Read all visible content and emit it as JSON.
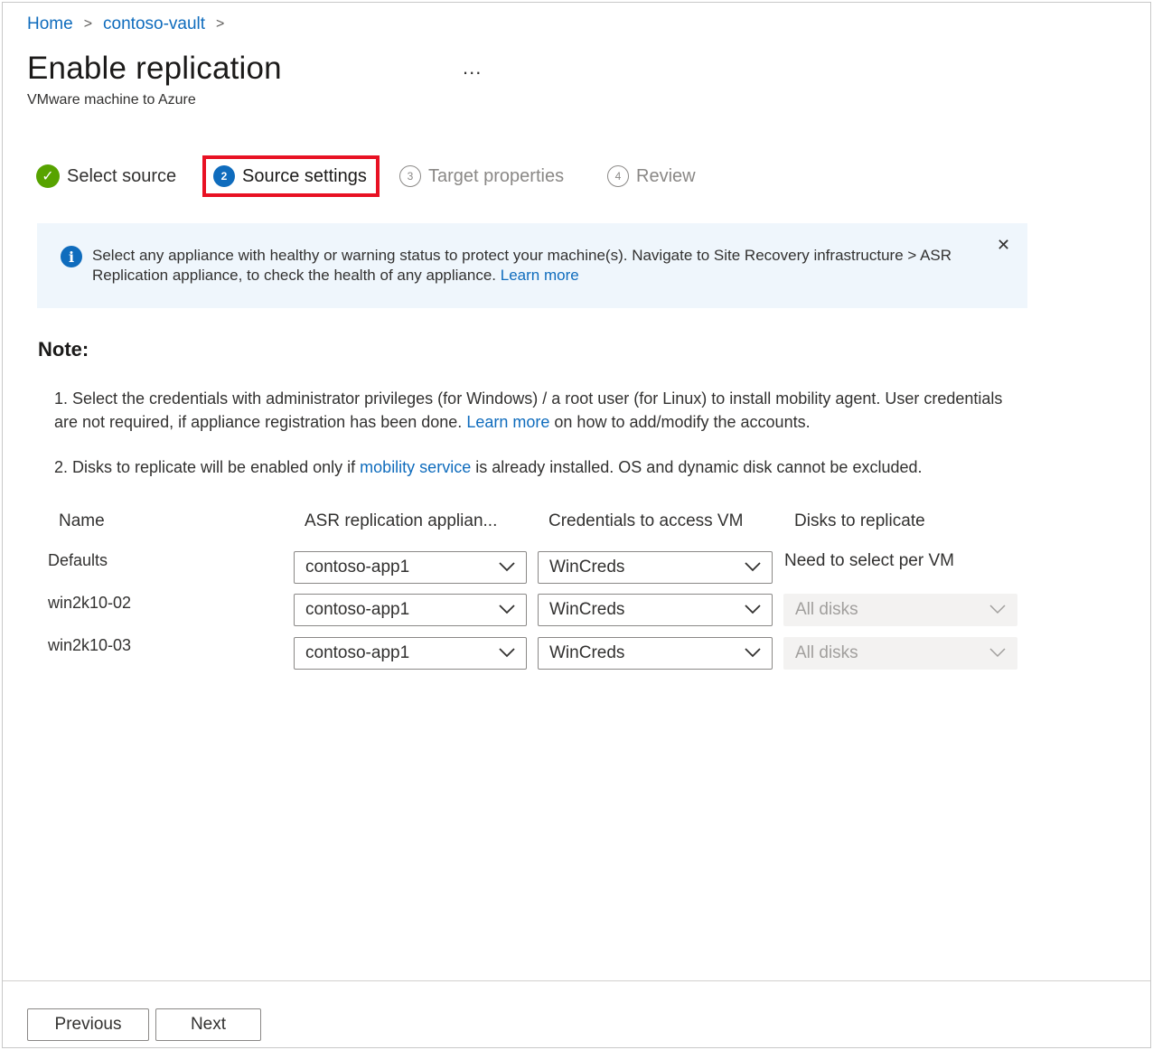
{
  "breadcrumb": {
    "items": [
      "Home",
      "contoso-vault"
    ],
    "separator": ">"
  },
  "header": {
    "title": "Enable replication",
    "subtitle": "VMware machine to Azure",
    "more": "..."
  },
  "steps": [
    {
      "marker": "✓",
      "label": "Select source",
      "state": "completed"
    },
    {
      "marker": "2",
      "label": "Source settings",
      "state": "current"
    },
    {
      "marker": "3",
      "label": "Target properties",
      "state": "upcoming"
    },
    {
      "marker": "4",
      "label": "Review",
      "state": "upcoming"
    }
  ],
  "info_bar": {
    "icon": "info-icon",
    "text": "Select any appliance with healthy or warning status to protect your machine(s). Navigate to Site Recovery infrastructure > ASR Replication appliance, to check the health of any appliance.",
    "link": "Learn more",
    "close": "✕"
  },
  "note": {
    "heading": "Note:",
    "item1": {
      "num": "1.",
      "text_a": "Select the credentials with administrator privileges (for Windows) / a root user (for Linux) to install mobility agent. User credentials are not required, if appliance registration has been done.",
      "link": "Learn more",
      "text_b": "on how to add/modify the accounts."
    },
    "item2": {
      "num": "2.",
      "text_a": "Disks to replicate will be enabled only if",
      "link": "mobility service",
      "text_b": "is already installed. OS and dynamic disk cannot be excluded."
    }
  },
  "table": {
    "headers": [
      "Name",
      "ASR replication applian...",
      "Credentials to access VM",
      "Disks to replicate"
    ],
    "rows": [
      {
        "name": "Defaults",
        "appliance": "contoso-app1",
        "credentials": "WinCreds",
        "disks": "Need to select per VM"
      },
      {
        "name": "win2k10-02",
        "appliance": "contoso-app1",
        "credentials": "WinCreds",
        "disks": "All disks"
      },
      {
        "name": "win2k10-03",
        "appliance": "contoso-app1",
        "credentials": "WinCreds",
        "disks": "All disks"
      }
    ]
  },
  "footer": {
    "previous": "Previous",
    "next": "Next"
  },
  "colors": {
    "link": "#0f6cbd",
    "success": "#57a300",
    "highlight": "#e81123",
    "info_background": "#eff6fc"
  }
}
